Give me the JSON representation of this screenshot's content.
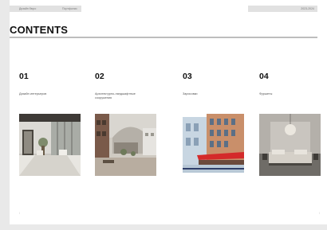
{
  "header": {
    "left_text_1": "Дизайн бюро",
    "left_text_2": "Портфолио",
    "right_text": "2023-2024"
  },
  "page": {
    "title": "CONTENTS"
  },
  "sections": [
    {
      "number": "01",
      "label": "Дизайн интерьеров",
      "image": "modern-lobby-photo"
    },
    {
      "number": "02",
      "label": "Архитектурно-ландшафтные сооружения",
      "image": "architecture-courtyard-photo"
    },
    {
      "number": "03",
      "label": "Зарисовки",
      "image": "watercolor-street-sketch"
    },
    {
      "number": "04",
      "label": "Фуршеты",
      "image": "minimal-bedroom-photo"
    }
  ],
  "footer": {
    "left_mark": "I",
    "right_mark": "I"
  }
}
